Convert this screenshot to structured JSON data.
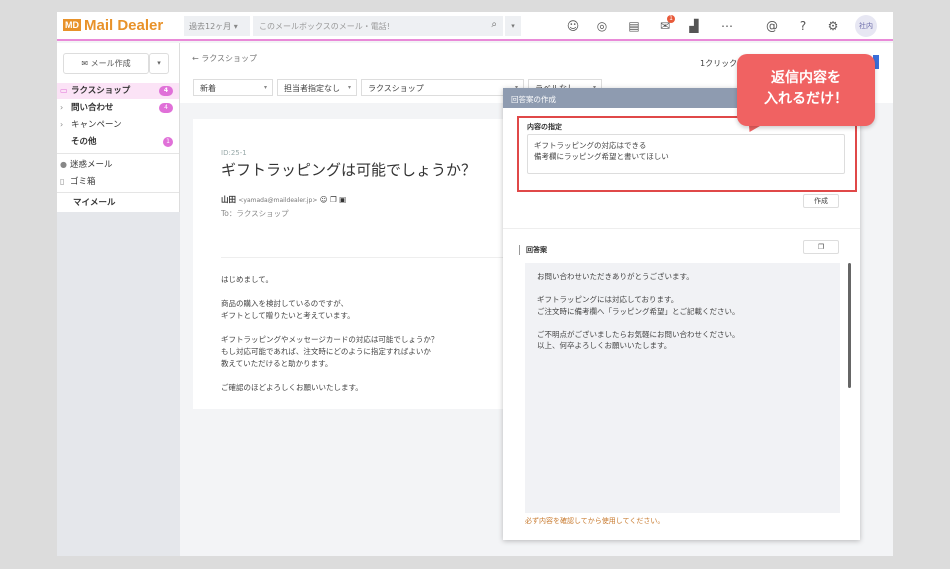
{
  "header": {
    "logo": "Mail Dealer",
    "logo_mark": "MD",
    "period": "過去12ヶ月",
    "search_placeholder": "このメールボックスのメール・電話!",
    "notification_count": "1",
    "avatar": "社内"
  },
  "sidebar": {
    "compose": "メール作成",
    "items": [
      {
        "label": "ラクスショップ",
        "count": "4"
      },
      {
        "label": "問い合わせ",
        "count": "4"
      },
      {
        "label": "キャンペーン"
      },
      {
        "label": "その他",
        "count": "1"
      },
      {
        "label": "迷惑メール"
      },
      {
        "label": "ゴミ箱"
      },
      {
        "label": "マイメール"
      }
    ]
  },
  "main": {
    "breadcrumb": "ラクスショップ",
    "filters": [
      "新着",
      "担当者指定なし",
      "ラクスショップ",
      "ラベルなし"
    ],
    "one_click": "1クリック"
  },
  "email": {
    "id": "ID:25-1",
    "subject": "ギフトラッピングは可能でしょうか？",
    "from_name": "山田",
    "from_email": "<yamada@maildealer.jp>",
    "to": "To：ラクスショップ",
    "body": "はじめまして。\n\n商品の購入を検討しているのですが、\nギフトとして贈りたいと考えています。\n\nギフトラッピングやメッセージカードの対応は可能でしょうか？\nもし対応可能であれば、注文時にどのように指定すればよいか\n教えていただけると助かります。\n\nご確認のほどよろしくお願いいたします。"
  },
  "panel": {
    "title": "回答案の作成",
    "content_label": "内容の指定",
    "content_value": "ギフトラッピングの対応はできる\n備考欄にラッピング希望と書いてほしい",
    "create": "作成",
    "answer_label": "回答案",
    "answer": "お問い合わせいただきありがとうございます。\n\nギフトラッピングには対応しております。\nご注文時に備考欄へ「ラッピング希望」とご記載ください。\n\nご不明点がございましたらお気軽にお問い合わせください。\n以上、何卒よろしくお願いいたします。",
    "warning": "必ず内容を確認してから使用してください。"
  },
  "callout": {
    "line1": "返信内容を",
    "line2": "入れるだけ！"
  }
}
